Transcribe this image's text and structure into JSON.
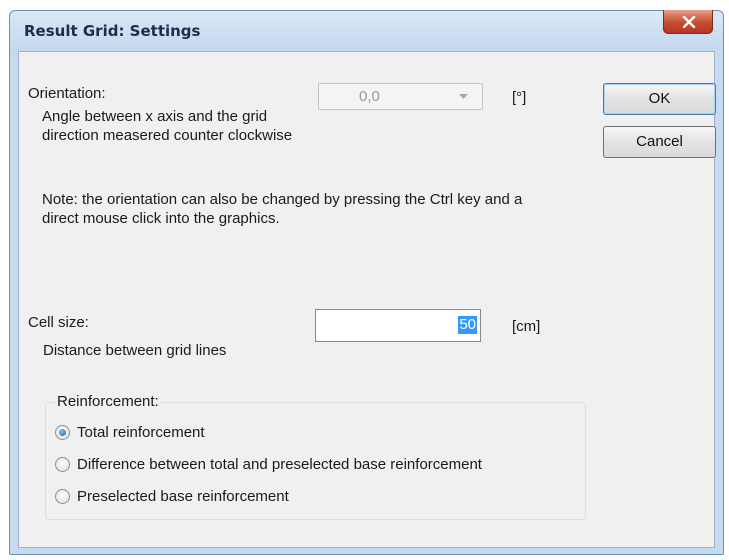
{
  "dialog": {
    "title": "Result Grid: Settings",
    "close_icon": "close-x-icon"
  },
  "orientation": {
    "label": "Orientation:",
    "description": "Angle between x axis and the grid direction measered counter clockwise",
    "value": "0,0",
    "unit": "[°]",
    "note": "Note: the orientation can also be changed by pressing the Ctrl key and a direct mouse click into the graphics."
  },
  "cell_size": {
    "label": "Cell size:",
    "description": "Distance between grid lines",
    "value": "50",
    "unit": "[cm]"
  },
  "reinforcement": {
    "title": "Reinforcement:",
    "options": [
      {
        "label": "Total reinforcement",
        "checked": true
      },
      {
        "label": "Difference between total and preselected base reinforcement",
        "checked": false
      },
      {
        "label": "Preselected base reinforcement",
        "checked": false
      }
    ]
  },
  "buttons": {
    "ok": "OK",
    "cancel": "Cancel"
  }
}
